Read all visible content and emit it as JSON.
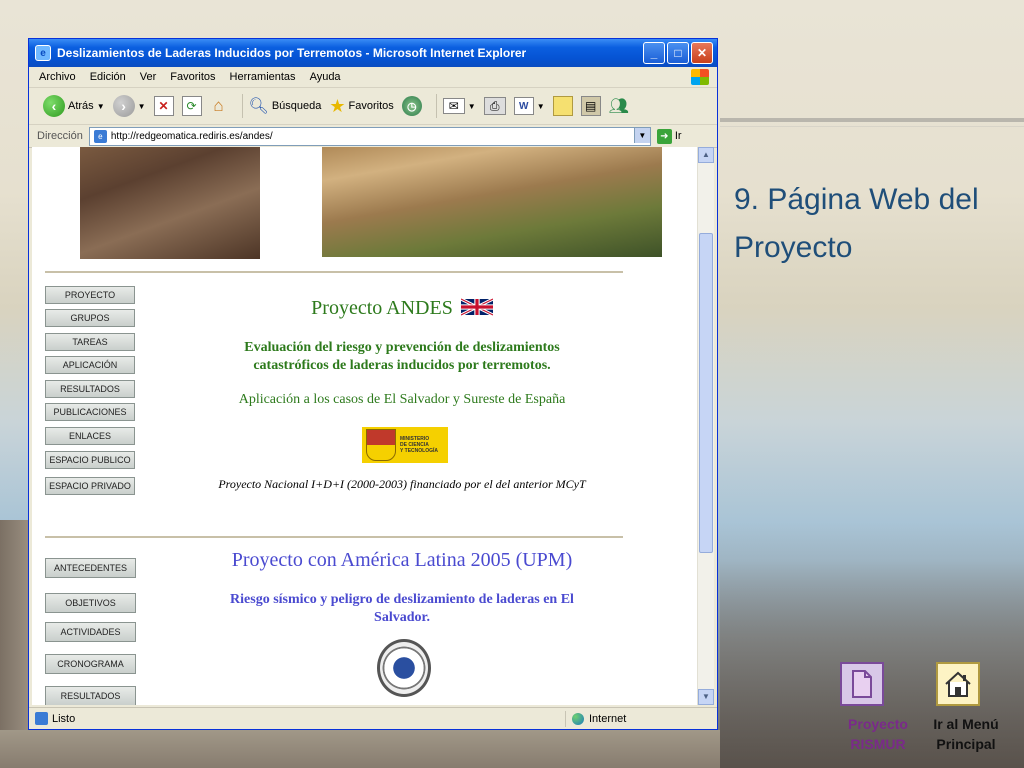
{
  "slide": {
    "title": "9. Página Web del Proyecto",
    "nav": {
      "proyecto_line1": "Proyecto",
      "proyecto_line2": "RISMUR",
      "menu_line1": "Ir al Menú",
      "menu_line2": "Principal"
    }
  },
  "browser": {
    "title": "Deslizamientos de Laderas Inducidos por Terremotos - Microsoft Internet Explorer",
    "menu": [
      "Archivo",
      "Edición",
      "Ver",
      "Favoritos",
      "Herramientas",
      "Ayuda"
    ],
    "toolbar": {
      "back": "Atrás",
      "search": "Búsqueda",
      "favorites": "Favoritos"
    },
    "address_label": "Dirección",
    "url": "http://redgeomatica.rediris.es/andes/",
    "go": "Ir",
    "status": "Listo",
    "zone": "Internet"
  },
  "page": {
    "nav_top": [
      "PROYECTO",
      "GRUPOS",
      "TAREAS",
      "APLICACIÓN",
      "RESULTADOS",
      "PUBLICACIONES",
      "ENLACES",
      "ESPACIO PUBLICO",
      "ESPACIO PRIVADO"
    ],
    "nav_bottom": [
      "ANTECEDENTES",
      "OBJETIVOS",
      "ACTIVIDADES",
      "CRONOGRAMA",
      "RESULTADOS"
    ],
    "andes_title": "Proyecto ANDES",
    "andes_sub1": "Evaluación del riesgo y prevención de deslizamientos",
    "andes_sub2": "catastróficos de laderas inducidos por terremotos.",
    "andes_app": "Aplicación a los casos de El Salvador y Sureste de España",
    "ministry_l1": "MINISTERIO",
    "ministry_l2": "DE CIENCIA",
    "ministry_l3": "Y TECNOLOGÍA",
    "nacional": "Proyecto Nacional I+D+I (2000-2003) financiado por el del anterior MCyT",
    "upm_title": "Proyecto con América Latina 2005 (UPM)",
    "upm_sub1": "Riesgo sísmico y peligro de deslizamiento de laderas en El",
    "upm_sub2": "Salvador."
  },
  "colors": {
    "slide_title": "#1f4e79",
    "andes_green": "#2d7a1c",
    "upm_blue": "#4a4ad0",
    "nav_label": "#7a2a8a"
  }
}
